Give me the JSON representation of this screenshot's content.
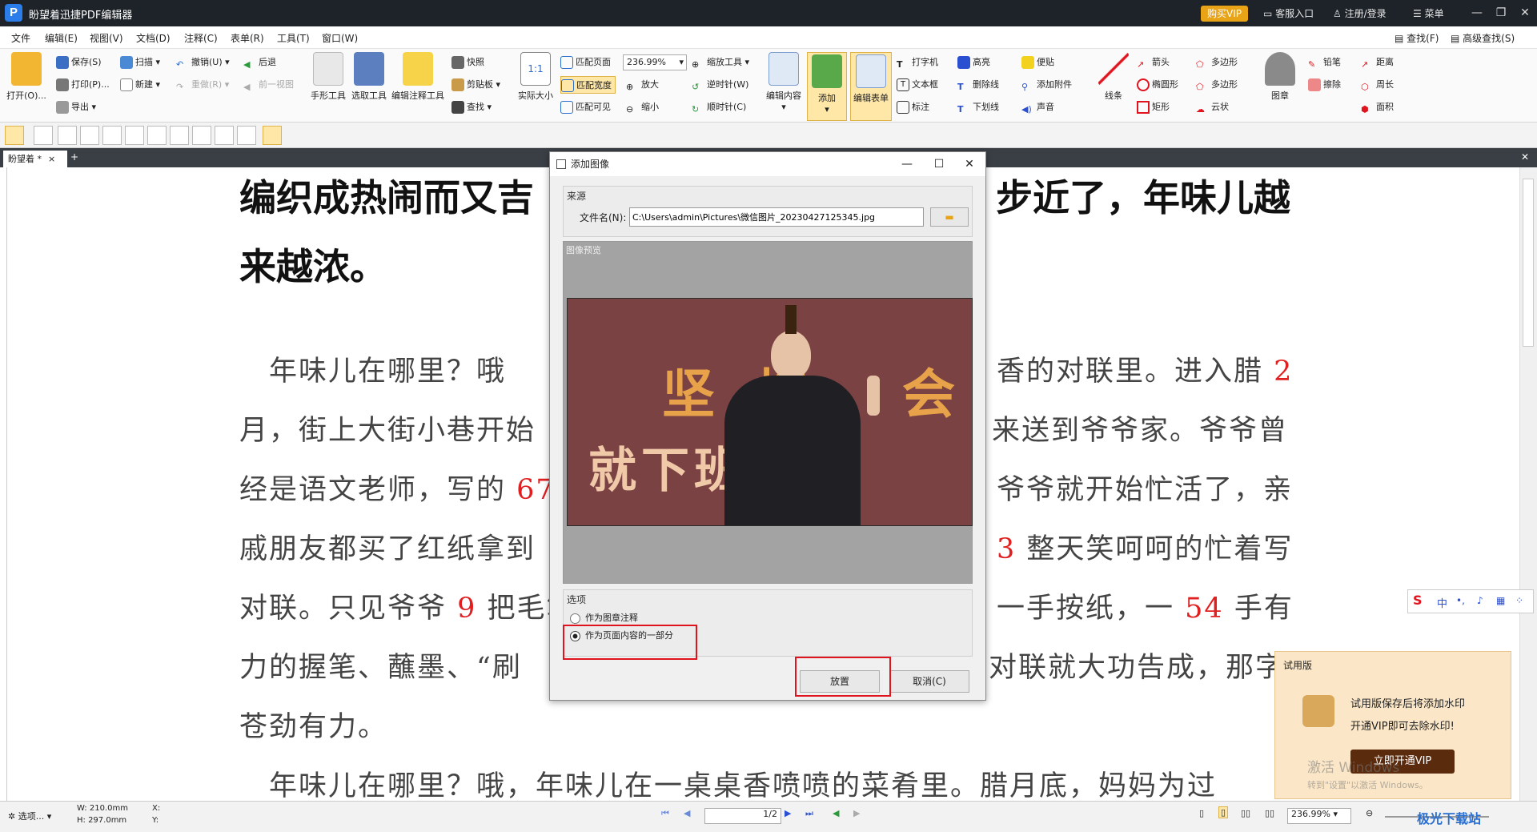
{
  "window": {
    "title": "盼望着迅捷PDF编辑器",
    "buy_vip": "购买VIP",
    "service": "客服入口",
    "login": "注册/登录",
    "menu": "菜单"
  },
  "menubar": {
    "items": [
      "文件",
      "编辑(E)",
      "视图(V)",
      "文档(D)",
      "注释(C)",
      "表单(R)",
      "工具(T)",
      "窗口(W)"
    ],
    "find": "查找(F)",
    "advanced_find": "高级查找(S)"
  },
  "ribbon": {
    "open": "打开(O)...",
    "save": "保存(S)",
    "print": "打印(P)...",
    "export": "导出",
    "scan": "扫描",
    "new": "新建",
    "undo": "撤销(U)",
    "redo": "重做(R)",
    "back": "后退",
    "prev_view": "前一视图",
    "hand": "手形工具",
    "select": "选取工具",
    "edit_annot": "编辑注释工具",
    "snapshot": "快照",
    "clipboard": "剪贴板",
    "find": "查找",
    "actual": "实际大小",
    "fit_page": "匹配页面",
    "fit_width": "匹配宽度",
    "fit_visible": "匹配可见",
    "zoom_value": "236.99%",
    "zoom_in": "放大",
    "zoom_out": "缩小",
    "zoom_tool": "缩放工具",
    "rotate_ccw": "逆时针(W)",
    "rotate_cw": "顺时针(C)",
    "edit_content": "编辑内容",
    "add": "添加",
    "edit_form": "编辑表单",
    "typewriter": "打字机",
    "textbox": "文本框",
    "callout": "标注",
    "highlight": "高亮",
    "strikeout": "删除线",
    "underline": "下划线",
    "note": "便贴",
    "attach": "添加附件",
    "sound": "声音",
    "line": "线条",
    "arrow": "箭头",
    "ellipse": "椭圆形",
    "rect": "矩形",
    "polygon": "多边形",
    "polyline": "多边形",
    "cloud": "云状",
    "stamp": "图章",
    "pencil": "铅笔",
    "eraser": "擦除",
    "distance": "距离",
    "perimeter": "周长",
    "area": "面积"
  },
  "tab": {
    "name": "盼望着 *"
  },
  "document": {
    "heading1": "编织成热闹而又吉",
    "heading1b": "步近了，年味儿越",
    "heading2": "来越浓。",
    "lines": [
      {
        "left": "　年味儿在哪里？哦",
        "right": "香的对联里。进入腊 ",
        "num": "2"
      },
      {
        "left": "月，街上大街小巷开始",
        "right": "来送到爷爷家。爷爷曾"
      },
      {
        "left": "经是语文老师，写的 ",
        "lnum": "67",
        "right": "爷爷就开始忙活了，亲"
      },
      {
        "left": "戚朋友都买了红纸拿到",
        "rnum": "3",
        "right": " 整天笑呵呵的忙着写"
      },
      {
        "left": "对联。只见爷爷 ",
        "lnum": "9",
        "left2": " 把毛笔",
        "right": "一手按纸，一 ",
        "num": "54",
        "right2": " 手有"
      },
      {
        "left": "力的握笔、蘸墨、“刷",
        "right": "对联就大功告成，那字"
      },
      {
        "left": "苍劲有力。",
        "right": ""
      },
      {
        "left": "　年味儿在哪里？哦，年味儿在一桌桌香喷喷的菜肴里。腊月底，妈妈为过",
        "right": ""
      }
    ]
  },
  "dialog": {
    "title": "添加图像",
    "source_label": "来源",
    "filename_label": "文件名(N):",
    "filename_value": "C:\\Users\\admin\\Pictures\\微信图片_20230427125345.jpg",
    "preview_label": "图像预览",
    "image_text1": "坚 持",
    "image_text2": "会",
    "image_text3": "就下班",
    "options_label": "选项",
    "option1": "作为图章注释",
    "option2": "作为页面内容的一部分",
    "selected_option": "作为页面内容的一部分",
    "ok": "放置",
    "cancel": "取消(C)"
  },
  "statusbar": {
    "options": "选项...",
    "width": "W: 210.0mm",
    "height": "H: 297.0mm",
    "x": "X:",
    "y": "Y:",
    "page": "1",
    "page_total": "/2",
    "zoom": "236.99%"
  },
  "trial": {
    "title": "试用版",
    "line1": "试用版保存后将添加水印",
    "line2": "开通VIP即可去除水印!",
    "button": "立即开通VIP",
    "win_activate": "激活 Windows",
    "win_hint": "转到\"设置\"以激活 Windows。"
  },
  "ime": {
    "lang": "中"
  },
  "watermark": "极光下载站"
}
